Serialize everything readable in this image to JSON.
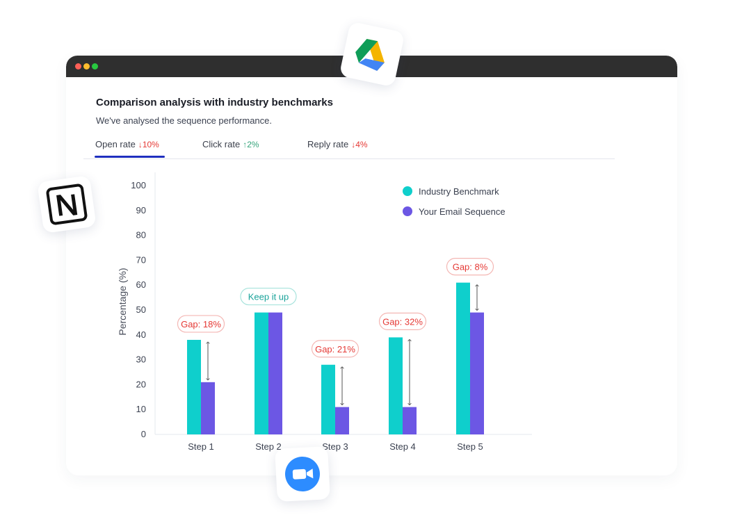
{
  "window": {
    "title": "Comparison analysis with industry benchmarks",
    "subtitle": "We've analysed the sequence performance."
  },
  "tabs": [
    {
      "label": "Open rate",
      "delta": "10%",
      "direction": "down",
      "active": true
    },
    {
      "label": "Click rate",
      "delta": "2%",
      "direction": "up",
      "active": false
    },
    {
      "label": "Reply rate",
      "delta": "4%",
      "direction": "down",
      "active": false
    }
  ],
  "icons": {
    "drive": "google-drive-icon",
    "notion": "notion-icon",
    "zoom": "zoom-icon",
    "window_dots": [
      "close-dot",
      "minimize-dot",
      "maximize-dot"
    ],
    "arrow_down": "↓",
    "arrow_up": "↑"
  },
  "colors": {
    "benchmark": "#0fcfcc",
    "sequence": "#6c57e4",
    "gap_text": "#e53935",
    "gap_border": "#f4b7b4",
    "positive_text": "#1aa39a",
    "positive_border": "#a7e3dc",
    "delta_down": "#e53935",
    "delta_up": "#34a37a",
    "tab_underline": "#1f2fbf",
    "titlebar": "#2f2f2f"
  },
  "chart_data": {
    "type": "bar",
    "categories": [
      "Step 1",
      "Step 2",
      "Step 3",
      "Step 4",
      "Step 5"
    ],
    "series": [
      {
        "name": "Industry Benchmark",
        "values": [
          38,
          49,
          28,
          39,
          61
        ]
      },
      {
        "name": "Your Email Sequence",
        "values": [
          21,
          49,
          11,
          11,
          49
        ]
      }
    ],
    "annotations": [
      "Gap: 18%",
      "Keep it up",
      "Gap: 21%",
      "Gap: 32%",
      "Gap: 8%"
    ],
    "annotation_kinds": [
      "gap",
      "positive",
      "gap",
      "gap",
      "gap"
    ],
    "ylabel": "Percentage (%)",
    "xlabel": "",
    "ylim": [
      0,
      100
    ],
    "yticks": [
      0,
      10,
      20,
      30,
      40,
      50,
      60,
      70,
      80,
      90,
      100
    ],
    "legend_position": "top-right",
    "grid": false
  }
}
